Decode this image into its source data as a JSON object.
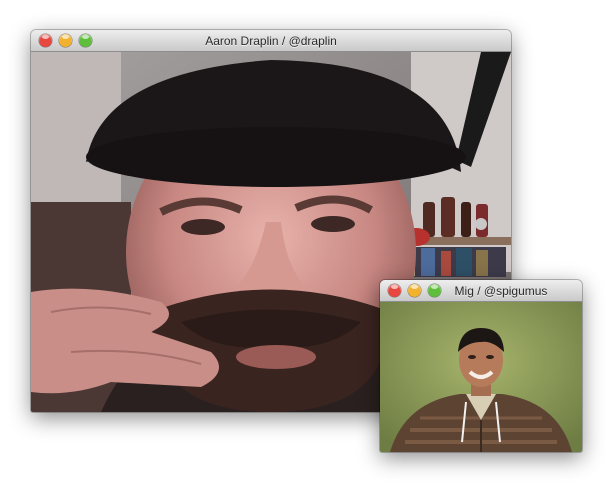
{
  "colors": {
    "close": "#e8473f",
    "minimize": "#f2b22e",
    "zoom": "#5fbf3c"
  },
  "main_window": {
    "title": "Aaron Draplin / @draplin"
  },
  "pip_window": {
    "title": "Mig / @spigumus"
  }
}
